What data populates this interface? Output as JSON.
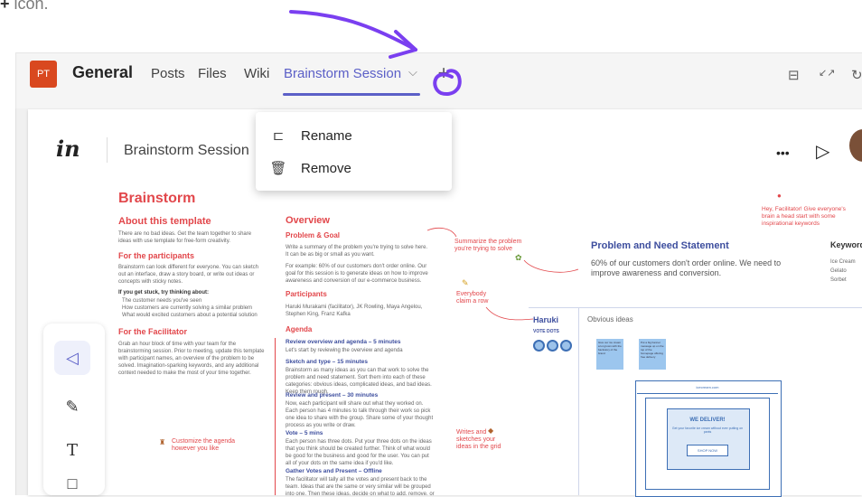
{
  "caption": {
    "plus": "+",
    "text": " icon."
  },
  "teams": {
    "avatar": "PT",
    "channel": "General",
    "tabs": [
      "Posts",
      "Files",
      "Wiki",
      "Brainstorm Session"
    ],
    "chevron": "⌵",
    "add": "+",
    "right_icons": [
      "⊟",
      "↙↗",
      "↻"
    ]
  },
  "menu": {
    "items": [
      {
        "icon": "⊏",
        "label": "Rename"
      },
      {
        "icon": "🗑",
        "label": "Remove"
      }
    ]
  },
  "app": {
    "logo": "in",
    "title": "Brainstorm Session",
    "more": "•••",
    "play": "▷"
  },
  "board": {
    "brainstorm": "Brainstorm",
    "about_title": "About this template",
    "about_text": "There are no bad ideas. Get the team together to share ideas with use template for free-form creativity.",
    "participants_title": "For the participants",
    "participants_text": "Brainstorm can look different for everyone. You can sketch out an interface, draw a story board, or write out ideas or concepts with sticky notes.",
    "stuck_title": "If you get stuck, try thinking about:",
    "stuck_items": [
      "The customer needs you've seen",
      "How customers are currently solving a similar problem",
      "What would excited customers about a potential solution"
    ],
    "facilitator_title": "For the Facilitator",
    "facilitator_text": "Grab an hour block of time with your team for the brainstorming session. Prior to meeting, update this template with participant names, an overview of the problem to be solved. Imagination-sparking keywords, and any additional context needed to make the most of your time together.",
    "customize_note": "Customize the agenda however you like",
    "overview_title": "Overview",
    "problem_title": "Problem & Goal",
    "problem_text1": "Write a summary of the problem you're trying to solve here. It can be as big or small as you want.",
    "problem_text2": "For example: 60% of our customers don't order online. Our goal for this session is to generate ideas on how to improve awareness and conversion of our e-commerce business.",
    "participants2_title": "Participants",
    "participants2_text": "Haruki Murakami (facilitator), JK Rowling, Maya Angelou, Stephen King, Franz Kafka",
    "agenda_title": "Agenda",
    "agenda": [
      {
        "title": "Review overview and agenda – 5 minutes",
        "text": "Let's start by reviewing the overview and agenda"
      },
      {
        "title": "Sketch and type – 15 minutes",
        "text": "Brainstorm as many ideas as you can that work to solve the problem and need statement. Sort them into each of these categories: obvious ideas, complicated ideas, and bad ideas. Keep them rough."
      },
      {
        "title": "Review and present – 30 minutes",
        "text": "Now, each participant will share out what they worked on. Each person has 4 minutes to talk through their work so pick one idea to share with the group. Share some of your thought process as you write or draw."
      },
      {
        "title": "Vote – 5 mins",
        "text": "Each person has three dots. Put your three dots on the ideas that you think should be created further. Think of what would be good for the business and good for the user. You can put all of your dots on the same idea if you'd like."
      },
      {
        "title": "Gather Votes and Present – Offline",
        "text": "The facilitator will tally all the votes and present back to the team. Ideas that are the same or very similar will be grouped into one. Then these ideas, decide on what to add, remove, or change."
      }
    ],
    "note_summarize": "Summarize the problem you're trying to solve",
    "note_everybody": "Everybody claim a row",
    "note_writes": "Writes and sketches your ideas in the grid",
    "note_hey": "Hey, Facilitator! Give everyone's brain a head start with some inspirational keywords",
    "statement_title": "Problem and Need Statement",
    "statement_text": "60% of our customers don't order online. We need to improve awareness and conversion.",
    "keywords_title": "Keywords",
    "keywords": [
      "Ice Cream",
      "Gelato",
      "Sorbet"
    ],
    "haruki": "Haruki",
    "vote_dots": "VOTE DOTS",
    "obvious": "Obvious ideas",
    "sticky1": "Give our ice cream a lot grown with the backstory of the brand",
    "sticky2": "Put a big banner message up on the top of the homepage offering free delivery",
    "site_url": "icecream.com",
    "we_deliver": "WE DELIVER!",
    "deliver_sub": "Get your favorite ice cream without ever putting on pants",
    "shop_now": "SHOP NOW"
  },
  "tools": [
    "◁",
    "✎",
    "T",
    "□"
  ],
  "colors": {
    "accent": "#5b5fc7",
    "brand_red": "#e2474b",
    "avatar": "#d9481f",
    "annotation": "#7a3ff0"
  }
}
